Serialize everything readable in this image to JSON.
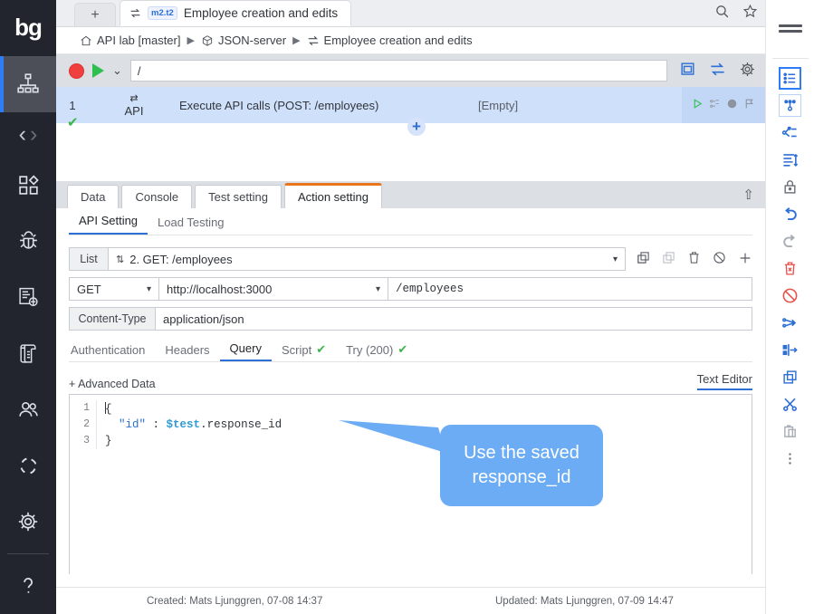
{
  "brand": {
    "logo_text": "bg"
  },
  "left_rail": {
    "items": [
      {
        "name": "sitemap-icon",
        "label": "Test structure",
        "active": true
      },
      {
        "name": "nav-back-icon",
        "label": "Back"
      },
      {
        "name": "nav-forward-icon",
        "label": "Forward"
      },
      {
        "name": "components-icon",
        "label": "Components"
      },
      {
        "name": "bug-icon",
        "label": "Defects"
      },
      {
        "name": "bug-report-icon",
        "label": "Bug reports"
      },
      {
        "name": "scroll-icon",
        "label": "Requirements"
      },
      {
        "name": "users-icon",
        "label": "Users"
      },
      {
        "name": "cycle-icon",
        "label": "Cycles"
      },
      {
        "name": "gear-icon",
        "label": "Settings"
      },
      {
        "name": "help-icon",
        "label": "Help"
      }
    ]
  },
  "tabstrip": {
    "new_tab_label": "+",
    "active_tab": {
      "badge": "m2.t2",
      "title": "Employee creation and edits"
    },
    "search_icon": "search-icon",
    "star_icon": "star-icon"
  },
  "breadcrumb": {
    "items": [
      {
        "icon": "home-icon",
        "label": "API lab [master]"
      },
      {
        "icon": "package-icon",
        "label": "JSON-server"
      },
      {
        "icon": "transfer-icon",
        "label": "Employee creation and edits"
      }
    ],
    "separator": "▶"
  },
  "runbar": {
    "record_label": "record-button",
    "play_label": "play-button",
    "dropdown_label": "⌄",
    "path_value": "/",
    "icons": [
      {
        "name": "window-icon"
      },
      {
        "name": "transfer-icon"
      },
      {
        "name": "gear-icon"
      }
    ]
  },
  "steps": {
    "rows": [
      {
        "num": "1",
        "status": "✔",
        "type_icon": "transfer-icon",
        "type": "API",
        "description": "Execute API calls (POST: /employees)",
        "value": "[Empty]",
        "actions": [
          "play-icon",
          "branch-icon",
          "clock-icon",
          "flag-icon"
        ]
      }
    ],
    "add_label": "+"
  },
  "panel": {
    "tabs": [
      {
        "label": "Data",
        "selected": false
      },
      {
        "label": "Console",
        "selected": false
      },
      {
        "label": "Test setting",
        "selected": false
      },
      {
        "label": "Action setting",
        "selected": true
      }
    ],
    "collapse_icon": "⇧"
  },
  "action_setting": {
    "subtabs": [
      {
        "label": "API Setting",
        "selected": true
      },
      {
        "label": "Load Testing",
        "selected": false
      }
    ],
    "list": {
      "label": "List",
      "updown_icon": "⇅",
      "value": "2. GET: /employees",
      "caret": "▾",
      "icons": [
        {
          "name": "copy-icon"
        },
        {
          "name": "paste-icon"
        },
        {
          "name": "delete-icon"
        },
        {
          "name": "disable-icon"
        },
        {
          "name": "add-icon"
        }
      ]
    },
    "request": {
      "method": "GET",
      "host": "http://localhost:3000",
      "path": "/employees",
      "caret": "▾"
    },
    "content_type": {
      "label": "Content-Type",
      "value": "application/json"
    },
    "inner_tabs": [
      {
        "label": "Authentication",
        "selected": false,
        "tick": false
      },
      {
        "label": "Headers",
        "selected": false,
        "tick": false
      },
      {
        "label": "Query",
        "selected": true,
        "tick": false
      },
      {
        "label": "Script",
        "selected": false,
        "tick": true
      },
      {
        "label": "Try (200)",
        "selected": false,
        "tick": true
      }
    ],
    "advanced_data_label": "+ Advanced Data",
    "text_editor_label": "Text Editor",
    "editor": {
      "lines": [
        {
          "num": "1",
          "segments": [
            {
              "text": "{",
              "type": "plain"
            }
          ]
        },
        {
          "num": "2",
          "segments": [
            {
              "text": "  ",
              "type": "plain"
            },
            {
              "text": "\"id\"",
              "type": "string"
            },
            {
              "text": " : ",
              "type": "plain"
            },
            {
              "text": "$test",
              "type": "variable"
            },
            {
              "text": ".response_id",
              "type": "plain"
            }
          ]
        },
        {
          "num": "3",
          "segments": [
            {
              "text": "}",
              "type": "plain"
            }
          ]
        }
      ]
    }
  },
  "callout": {
    "text": "Use the saved\nresponse_id",
    "color": "#6cacf5"
  },
  "footer": {
    "created": "Created: Mats Ljunggren, 07-08 14:37",
    "updated": "Updated: Mats Ljunggren, 07-09 14:47"
  },
  "right_rail": {
    "hamburger": "menu-icon",
    "items": [
      {
        "name": "list-view-icon",
        "style": "boxed-blue"
      },
      {
        "name": "mindmap-icon",
        "style": "boxed-light"
      },
      {
        "name": "branch-merge-icon",
        "style": "blue"
      },
      {
        "name": "indent-icon",
        "style": "blue"
      },
      {
        "name": "lock-icon",
        "style": "gray"
      },
      {
        "name": "undo-icon",
        "style": "blue"
      },
      {
        "name": "redo-icon",
        "style": "gray"
      },
      {
        "name": "delete-icon",
        "style": "red"
      },
      {
        "name": "disable-icon",
        "style": "red"
      },
      {
        "name": "split-icon",
        "style": "blue"
      },
      {
        "name": "move-icon",
        "style": "blue"
      },
      {
        "name": "copy-icon",
        "style": "blue"
      },
      {
        "name": "cut-icon",
        "style": "blue"
      },
      {
        "name": "paste-icon",
        "style": "gray"
      },
      {
        "name": "more-icon",
        "style": "gray"
      }
    ]
  },
  "colors": {
    "accent_blue": "#2e6fd6",
    "rail_bg": "#22252e",
    "step_row_bg": "#cfe0fa",
    "selected_tab_orange": "#e8741c",
    "callout_blue": "#6cacf5",
    "success_green": "#3cb54a",
    "record_red": "#ef3f3f"
  }
}
